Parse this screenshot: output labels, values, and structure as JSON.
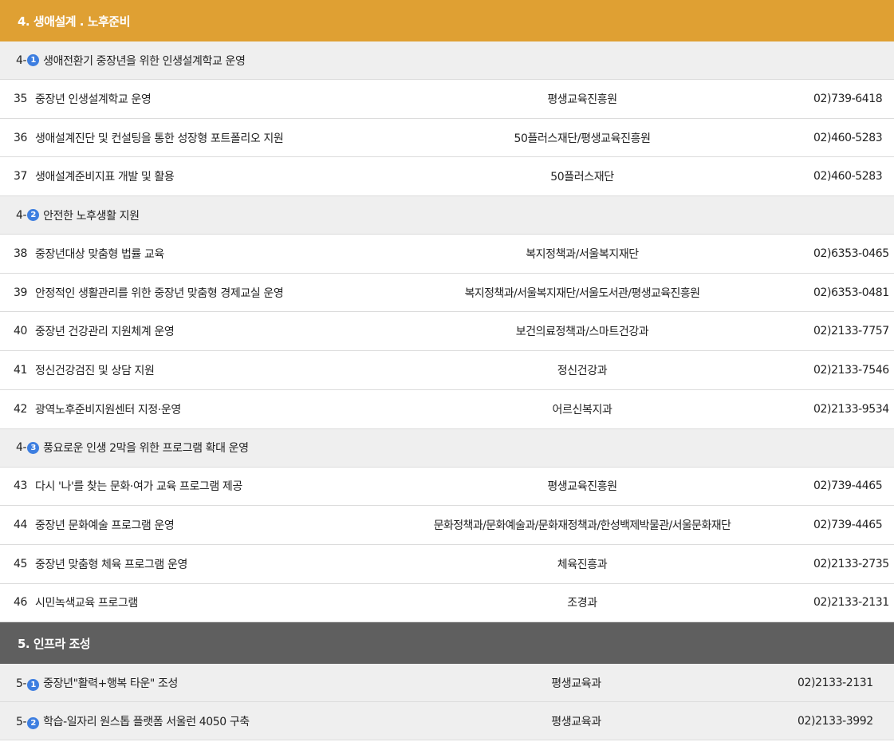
{
  "section4": {
    "title": "4. 생애설계 . 노후준비",
    "groups": [
      {
        "prefix": "4-",
        "badge": "1",
        "label": "생애전환기 중장년을 위한 인생설계학교 운영",
        "rows": [
          {
            "num": "35",
            "title": "중장년 인생설계학교 운영",
            "dept": "평생교육진흥원",
            "phone": "02)739-6418"
          },
          {
            "num": "36",
            "title": "생애설계진단 및 컨설팅을 통한 성장형 포트폴리오 지원",
            "dept": "50플러스재단/평생교육진흥원",
            "phone": "02)460-5283"
          },
          {
            "num": "37",
            "title": "생애설계준비지표 개발 및 활용",
            "dept": "50플러스재단",
            "phone": "02)460-5283"
          }
        ]
      },
      {
        "prefix": "4-",
        "badge": "2",
        "label": "안전한 노후생활 지원",
        "rows": [
          {
            "num": "38",
            "title": "중장년대상 맞춤형 법률 교육",
            "dept": "복지정책과/서울복지재단",
            "phone": "02)6353-0465"
          },
          {
            "num": "39",
            "title": "안정적인 생활관리를 위한 중장년 맞춤형 경제교실 운영",
            "dept": "복지정책과/서울복지재단/서울도서관/평생교육진흥원",
            "phone": "02)6353-0481"
          },
          {
            "num": "40",
            "title": "중장년 건강관리 지원체계 운영",
            "dept": "보건의료정책과/스마트건강과",
            "phone": "02)2133-7757"
          },
          {
            "num": "41",
            "title": "정신건강검진 및 상담 지원",
            "dept": "정신건강과",
            "phone": "02)2133-7546"
          },
          {
            "num": "42",
            "title": "광역노후준비지원센터 지정·운영",
            "dept": "어르신복지과",
            "phone": "02)2133-9534"
          }
        ]
      },
      {
        "prefix": "4-",
        "badge": "3",
        "label": "풍요로운 인생 2막을 위한 프로그램 확대 운영",
        "rows": [
          {
            "num": "43",
            "title": "다시 '나'를 찾는 문화·여가 교육 프로그램 제공",
            "dept": "평생교육진흥원",
            "phone": "02)739-4465"
          },
          {
            "num": "44",
            "title": "중장년 문화예술 프로그램 운영",
            "dept": "문화정책과/문화예술과/문화재정책과/한성백제박물관/서울문화재단",
            "phone": "02)739-4465"
          },
          {
            "num": "45",
            "title": "중장년 맞춤형 체육 프로그램 운영",
            "dept": "체육진흥과",
            "phone": "02)2133-2735"
          },
          {
            "num": "46",
            "title": "시민녹색교육 프로그램",
            "dept": "조경과",
            "phone": "02)2133-2131"
          }
        ]
      }
    ]
  },
  "section5": {
    "title": "5. 인프라 조성",
    "rows": [
      {
        "prefix": "5-",
        "badge": "1",
        "label": "중장년\"활력+행복 타운\" 조성",
        "dept": "평생교육과",
        "phone": "02)2133-2131"
      },
      {
        "prefix": "5-",
        "badge": "2",
        "label": "학습-일자리 원스톱 플랫폼 서울런 4050 구축",
        "dept": "평생교육과",
        "phone": "02)2133-3992"
      }
    ]
  },
  "colors": {
    "gold": "#dfa033",
    "gray": "#5f5f5f",
    "badge": "#3d7ee0",
    "subbg": "#efefef"
  }
}
